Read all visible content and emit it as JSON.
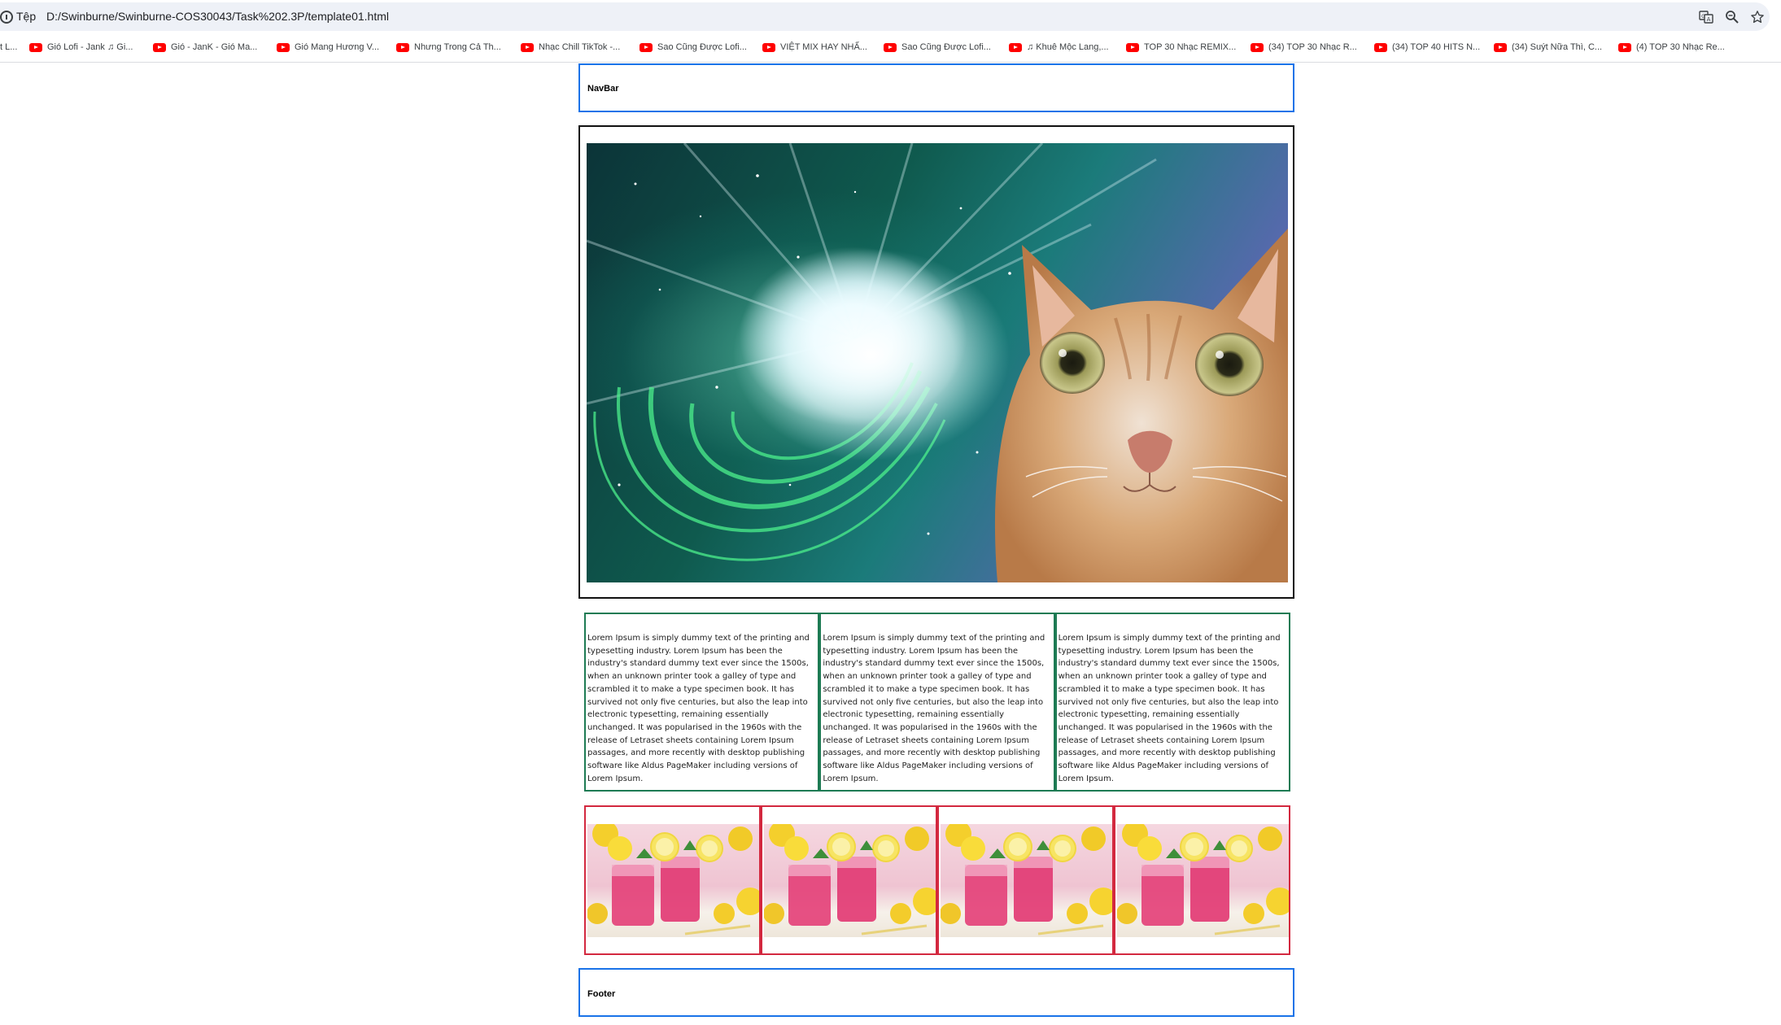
{
  "browser": {
    "scheme_label": "Tệp",
    "url": "D:/Swinburne/Swinburne-COS30043/Task%202.3P/template01.html",
    "icons": [
      "info-icon",
      "translate-icon",
      "zoom-icon",
      "star-icon"
    ],
    "bookmarks": [
      {
        "label": "t L...",
        "icon": "none"
      },
      {
        "label": "Gió Lofi - Jank ♫ Gi...",
        "icon": "youtube-icon"
      },
      {
        "label": "Gió - JanK - Gió Ma...",
        "icon": "youtube-icon"
      },
      {
        "label": "Gió Mang Hương V...",
        "icon": "youtube-icon"
      },
      {
        "label": "Nhưng Trong Cả Th...",
        "icon": "youtube-icon"
      },
      {
        "label": "Nhạc Chill TikTok -...",
        "icon": "youtube-icon"
      },
      {
        "label": "Sao Cũng Được Lofi...",
        "icon": "youtube-icon"
      },
      {
        "label": "VIỆT MIX HAY NHẤ...",
        "icon": "youtube-icon"
      },
      {
        "label": "Sao Cũng Được Lofi...",
        "icon": "youtube-icon"
      },
      {
        "label": "♫ Khuê Mộc Lang,...",
        "icon": "youtube-icon"
      },
      {
        "label": "TOP 30 Nhạc REMIX...",
        "icon": "youtube-icon"
      },
      {
        "label": "(34) TOP 30 Nhạc R...",
        "icon": "youtube-icon"
      },
      {
        "label": "(34) TOP 40 HITS N...",
        "icon": "youtube-icon"
      },
      {
        "label": "(34) Suýt Nữa Thì, C...",
        "icon": "youtube-icon"
      },
      {
        "label": "(4) TOP 30 Nhạc Re...",
        "icon": "youtube-icon"
      }
    ]
  },
  "page": {
    "navbar_label": "NavBar",
    "hero_image": "space-cat-image",
    "columns": [
      {
        "text": "Lorem Ipsum is simply dummy text of the printing and typesetting industry. Lorem Ipsum has been the industry's standard dummy text ever since the 1500s, when an unknown printer took a galley of type and scrambled it to make a type specimen book. It has survived not only five centuries, but also the leap into electronic typesetting, remaining essentially unchanged. It was popularised in the 1960s with the release of Letraset sheets containing Lorem Ipsum passages, and more recently with desktop publishing software like Aldus PageMaker including versions of Lorem Ipsum."
      },
      {
        "text": "Lorem Ipsum is simply dummy text of the printing and typesetting industry. Lorem Ipsum has been the industry's standard dummy text ever since the 1500s, when an unknown printer took a galley of type and scrambled it to make a type specimen book. It has survived not only five centuries, but also the leap into electronic typesetting, remaining essentially unchanged. It was popularised in the 1960s with the release of Letraset sheets containing Lorem Ipsum passages, and more recently with desktop publishing software like Aldus PageMaker including versions of Lorem Ipsum."
      },
      {
        "text": "Lorem Ipsum is simply dummy text of the printing and typesetting industry. Lorem Ipsum has been the industry's standard dummy text ever since the 1500s, when an unknown printer took a galley of type and scrambled it to make a type specimen book. It has survived not only five centuries, but also the leap into electronic typesetting, remaining essentially unchanged. It was popularised in the 1960s with the release of Letraset sheets containing Lorem Ipsum passages, and more recently with desktop publishing software like Aldus PageMaker including versions of Lorem Ipsum."
      }
    ],
    "gallery_images": [
      "pink-lemonade-image",
      "pink-lemonade-image",
      "pink-lemonade-image",
      "pink-lemonade-image"
    ],
    "footer_label": "Footer"
  },
  "colors": {
    "navbar_border": "#1a73e8",
    "hero_border": "#111111",
    "text_column_border": "#1e7b54",
    "gallery_border": "#d3283f",
    "footer_border": "#1a73e8"
  }
}
